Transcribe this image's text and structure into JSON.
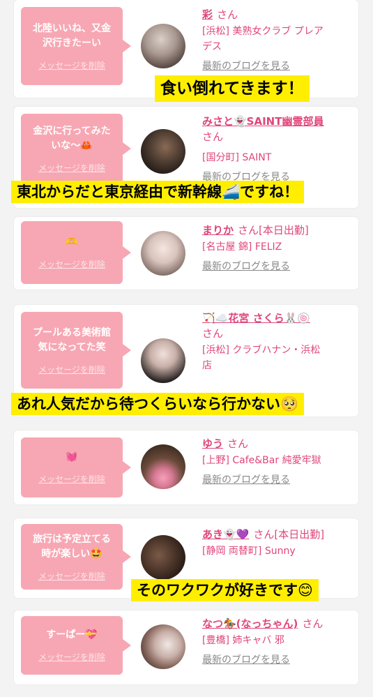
{
  "delete_label": "メッセージを削除",
  "blog_label": "最新のブログを見る",
  "san": "さん",
  "cards": [
    {
      "message": "北陸いいね、又金\n沢行きたーい",
      "name": "彩",
      "shift": "",
      "shop": "[浜松] 美熟女クラブ プレア\nデス"
    },
    {
      "message": "金沢に行ってみた\nいな〜🦀",
      "name": "みさと👻SAINT幽霊部員",
      "shift": "",
      "shop": "[国分町] SAINT"
    },
    {
      "message": "🫶",
      "name": "まりか",
      "shift": "[本日出勤]",
      "shop": "[名古屋 錦] FELIZ"
    },
    {
      "message": "プールある美術館\n気になってた笑",
      "name": "🏹☁️花宮 さくら🐰🍥",
      "shift": "",
      "shop": "[浜松] クラブハナン・浜松\n店"
    },
    {
      "message": "💓",
      "name": "ゆう",
      "shift": "",
      "shop": "[上野] Cafe&Bar 純愛牢獄"
    },
    {
      "message": "旅行は予定立てる\n時が楽しい🤩",
      "name": "あき👻💜",
      "shift": "[本日出勤]",
      "shop": "[静岡 両替町] Sunny"
    },
    {
      "message": "すーぱー💝",
      "name": "なつ🏇(なっちゃん)",
      "shift": "",
      "shop": "[豊橋] 姉キャバ 邪"
    }
  ],
  "captions": [
    "食い倒れてきます！",
    "東北からだと東京経由で新幹線🚄ですね！",
    "あれ人気だから待つくらいなら行かない🥺",
    "そのワクワクが好きです😊"
  ],
  "colors": {
    "bubble": "#f7a7b3",
    "accent": "#e0457b",
    "caption_bg": "#ffee00"
  }
}
